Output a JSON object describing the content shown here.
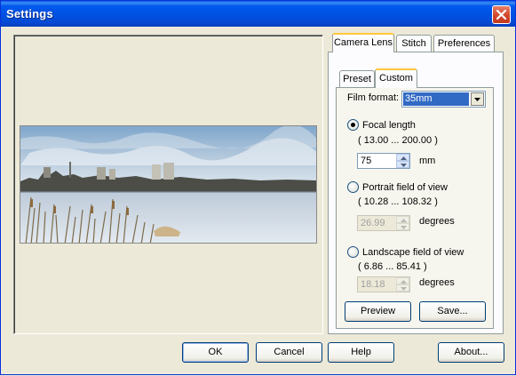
{
  "window": {
    "title": "Settings",
    "close_icon": "close-icon"
  },
  "tabs": [
    "Camera Lens",
    "Stitch",
    "Preferences"
  ],
  "subtabs": [
    "Preset",
    "Custom"
  ],
  "film_format": {
    "label": "Film format:",
    "value": "35mm"
  },
  "focal_length": {
    "label": "Focal length",
    "range": "( 13.00  ...  200.00 )",
    "value": "75",
    "unit": "mm",
    "selected": true
  },
  "portrait_fov": {
    "label": "Portrait field of view",
    "range": "( 10.28  ...  108.32 )",
    "value": "26.99",
    "unit": "degrees",
    "selected": false
  },
  "landscape_fov": {
    "label": "Landscape field of view",
    "range": "( 6.86  ...  85.41 )",
    "value": "18.18",
    "unit": "degrees",
    "selected": false
  },
  "panel_buttons": {
    "preview": "Preview",
    "save": "Save..."
  },
  "bottom_buttons": {
    "ok": "OK",
    "cancel": "Cancel",
    "help": "Help",
    "about": "About..."
  },
  "colors": {
    "title_bar": "#0058ee",
    "selection": "#316ac5",
    "face": "#ece9d8"
  }
}
